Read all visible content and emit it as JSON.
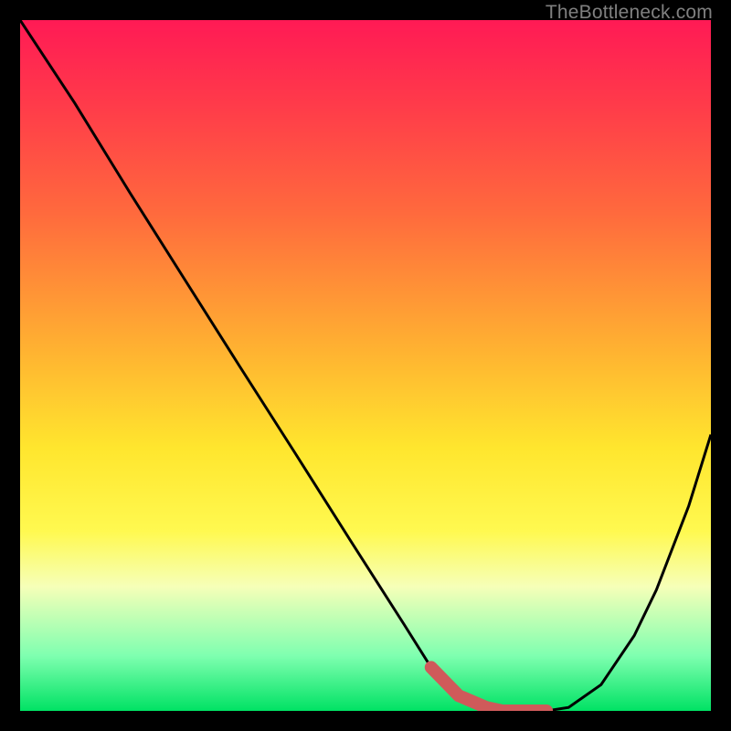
{
  "watermark": {
    "text": "TheBottleneck.com"
  },
  "chart_data": {
    "type": "line",
    "title": "",
    "xlabel": "",
    "ylabel": "",
    "xlim": [
      0,
      100
    ],
    "ylim": [
      0,
      100
    ],
    "grid": false,
    "legend": false,
    "background_gradient": {
      "top": "#ff1a55",
      "mid": "#ffe62e",
      "bottom": "#00e264"
    },
    "series": [
      {
        "name": "bottleneck-curve",
        "color": "#000000",
        "x": [
          0,
          7.9,
          15.9,
          23.8,
          31.7,
          39.7,
          47.6,
          55.6,
          59.5,
          63.5,
          67.5,
          69.8,
          73.0,
          76.2,
          79.4,
          84.1,
          88.9,
          92.1,
          96.8,
          100
        ],
        "values": [
          100,
          88,
          75,
          62.5,
          50,
          37.5,
          25,
          12.5,
          6.3,
          2.2,
          0.5,
          0,
          0,
          0,
          0.5,
          3.8,
          10.9,
          17.5,
          29.7,
          40
        ]
      },
      {
        "name": "optimal-segment",
        "color": "#cf5a5a",
        "stroke_width": 14,
        "linecap": "round",
        "x": [
          59.5,
          63.5,
          67.5,
          69.8,
          73.0,
          76.2
        ],
        "values": [
          6.3,
          2.2,
          0.5,
          0,
          0,
          0
        ]
      }
    ]
  }
}
